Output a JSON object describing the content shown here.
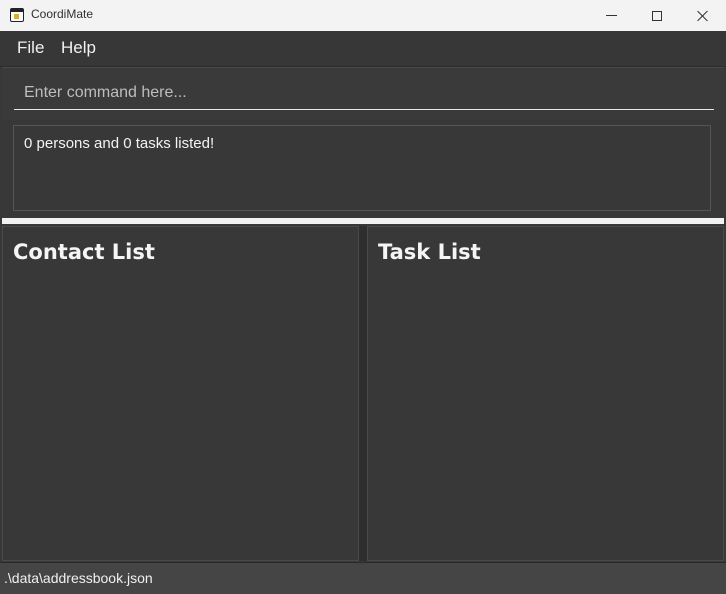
{
  "window": {
    "title": "CoordiMate",
    "icon": "calendar-icon",
    "controls": {
      "minimize": "minimize-icon",
      "maximize": "maximize-icon",
      "close": "close-icon"
    }
  },
  "menu": {
    "items": [
      {
        "label": "File"
      },
      {
        "label": "Help"
      }
    ]
  },
  "command": {
    "value": "",
    "placeholder": "Enter command here..."
  },
  "result": {
    "text": "0 persons and 0 tasks listed!"
  },
  "panels": {
    "contacts": {
      "title": "Contact List",
      "items": []
    },
    "tasks": {
      "title": "Task List",
      "items": []
    }
  },
  "status": {
    "file_path": ".\\data\\addressbook.json"
  },
  "colors": {
    "background": "#383838",
    "titlebar": "#f3f3f3",
    "separator": "#f2f2f2",
    "text": "#f0f0f0"
  }
}
